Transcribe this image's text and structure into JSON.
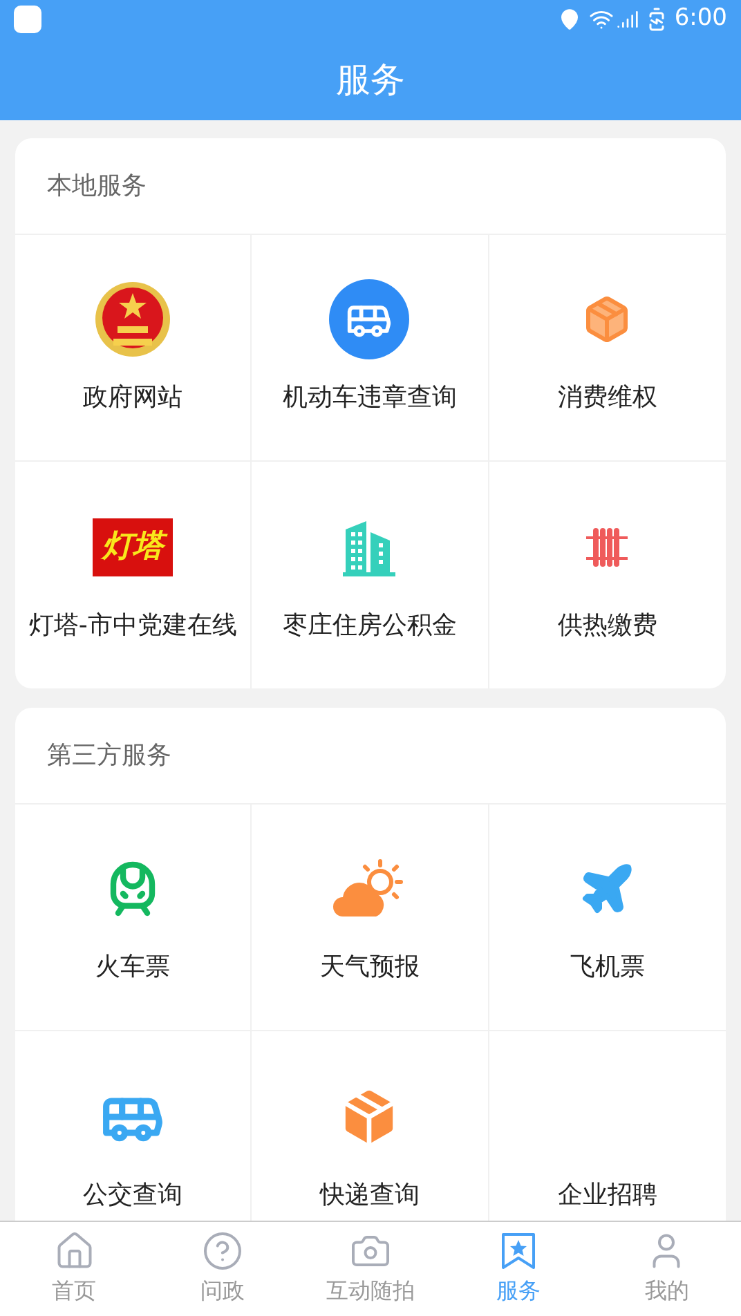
{
  "status_bar": {
    "time": "6:00"
  },
  "title": "服务",
  "sections": [
    {
      "title": "本地服务",
      "items": [
        {
          "label": "政府网站",
          "kind": "emblem"
        },
        {
          "label": "机动车违章查询",
          "kind": "buscircle"
        },
        {
          "label": "消费维权",
          "kind": "parcel"
        },
        {
          "label": "灯塔-市中党建在线",
          "kind": "logo",
          "logo_text": "灯塔"
        },
        {
          "label": "枣庄住房公积金",
          "kind": "building"
        },
        {
          "label": "供热缴费",
          "kind": "radiator"
        }
      ]
    },
    {
      "title": "第三方服务",
      "items": [
        {
          "label": "火车票",
          "kind": "train"
        },
        {
          "label": "天气预报",
          "kind": "weather"
        },
        {
          "label": "飞机票",
          "kind": "plane"
        },
        {
          "label": "公交查询",
          "kind": "bus"
        },
        {
          "label": "快递查询",
          "kind": "box"
        },
        {
          "label": "企业招聘"
        }
      ]
    }
  ],
  "tabs": [
    {
      "label": "首页",
      "kind": "home",
      "selected": false
    },
    {
      "label": "问政",
      "kind": "question",
      "selected": false
    },
    {
      "label": "互动随拍",
      "kind": "camera",
      "selected": false
    },
    {
      "label": "服务",
      "kind": "star",
      "selected": true
    },
    {
      "label": "我的",
      "kind": "user",
      "selected": false
    }
  ]
}
